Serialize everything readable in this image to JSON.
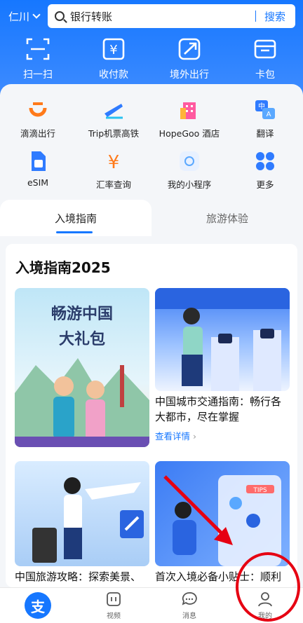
{
  "header": {
    "city": "仁川",
    "search_placeholder": "银行转账",
    "search_button": "搜索"
  },
  "quick_actions": [
    {
      "label": "扫一扫",
      "icon": "scan-icon"
    },
    {
      "label": "收付款",
      "icon": "pay-receive-icon"
    },
    {
      "label": "境外出行",
      "icon": "travel-abroad-icon"
    },
    {
      "label": "卡包",
      "icon": "wallet-icon"
    }
  ],
  "services": [
    {
      "label": "滴滴出行",
      "icon": "didi-icon"
    },
    {
      "label": "Trip机票高铁",
      "icon": "trip-icon"
    },
    {
      "label": "HopeGoo 酒店",
      "icon": "hotel-icon"
    },
    {
      "label": "翻译",
      "icon": "translate-icon"
    },
    {
      "label": "eSIM",
      "icon": "esim-icon"
    },
    {
      "label": "汇率查询",
      "icon": "exchange-rate-icon"
    },
    {
      "label": "我的小程序",
      "icon": "mini-program-icon"
    },
    {
      "label": "更多",
      "icon": "more-icon"
    }
  ],
  "tabs": [
    {
      "label": "入境指南"
    },
    {
      "label": "旅游体验"
    }
  ],
  "guide": {
    "title": "入境指南2025",
    "poster_text_line1": "畅游中国",
    "poster_text_line2": "大礼包",
    "card2_title": "中国城市交通指南：畅行各大都市，尽在掌握",
    "card2_more": "查看详情",
    "card3_title": "中国旅游攻略：探索美景、",
    "card4_title": "首次入境必备小贴士：顺利",
    "card4_badge": "TIPS"
  },
  "bottom_nav": [
    {
      "label": "",
      "icon": "alipay-home-icon"
    },
    {
      "label": "视频",
      "icon": "video-icon"
    },
    {
      "label": "消息",
      "icon": "message-icon"
    },
    {
      "label": "我的",
      "icon": "profile-icon"
    }
  ],
  "colors": {
    "accent": "#1677ff",
    "annotation": "#e60012"
  }
}
